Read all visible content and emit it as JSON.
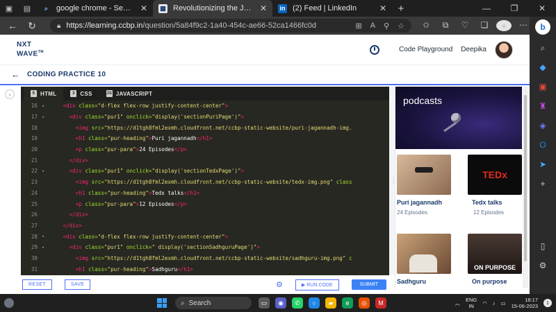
{
  "browser": {
    "tabs": [
      {
        "title": "google chrome - Search",
        "favicon": "search-icon",
        "active": false
      },
      {
        "title": "Revolutionizing the Job Market |",
        "favicon": "ccbp-icon",
        "active": true
      },
      {
        "title": "(2) Feed | LinkedIn",
        "favicon": "in",
        "active": false
      }
    ],
    "url_host": "https://learning.ccbp.in",
    "url_path": "/question/5a84f9c2-1a40-454c-ae66-52ca1466fc0d"
  },
  "header": {
    "logo_line1": "NXT",
    "logo_line2": "WAVE",
    "logo_tm": "TM",
    "code_playground": "Code Playground",
    "username": "Deepika"
  },
  "practice": {
    "title": "CODING PRACTICE 10"
  },
  "editor": {
    "tabs": [
      {
        "label": "HTML",
        "icon": "html-file-icon",
        "active": true
      },
      {
        "label": "CSS",
        "icon": "css-file-icon",
        "active": false
      },
      {
        "label": "JAVASCRIPT",
        "icon": "js-file-icon",
        "active": false
      }
    ],
    "lines": [
      {
        "n": "16",
        "fold": true,
        "indent": 4,
        "tag": "<div",
        "attrs": [
          [
            "class=",
            "\"d-flex flex-row justify-content-center\""
          ]
        ],
        "tail": ">"
      },
      {
        "n": "17",
        "fold": true,
        "indent": 6,
        "tag": "<div",
        "attrs": [
          [
            "class=",
            "\"pur1\""
          ],
          [
            " onclick=",
            "\"display('sectionPuriPage')\""
          ]
        ],
        "tail": ">"
      },
      {
        "n": "18",
        "fold": false,
        "indent": 8,
        "tag": "<img",
        "attrs": [
          [
            "src=",
            "\"https://d1tgh8fml2exmh.cloudfront.net/ccbp-static-website/puri-jagannadh-img."
          ]
        ],
        "tail": ""
      },
      {
        "n": "19",
        "fold": false,
        "indent": 8,
        "tag": "<h1",
        "attrs": [
          [
            "class=",
            "\"pur-heading\""
          ]
        ],
        "tail": ">Puri jagannadh</h1>"
      },
      {
        "n": "20",
        "fold": false,
        "indent": 8,
        "tag": "<p",
        "attrs": [
          [
            "class=",
            "\"pur-para\""
          ]
        ],
        "tail": ">24 Episodes</p>"
      },
      {
        "n": "21",
        "fold": false,
        "indent": 6,
        "tag": "</div>",
        "attrs": [],
        "tail": ""
      },
      {
        "n": "22",
        "fold": true,
        "indent": 6,
        "tag": "<div",
        "attrs": [
          [
            "class=",
            "\"pur1\""
          ],
          [
            " onclick=",
            "\"display('sectionTedxPage')\""
          ]
        ],
        "tail": ">"
      },
      {
        "n": "23",
        "fold": false,
        "indent": 8,
        "tag": "<img",
        "attrs": [
          [
            "src=",
            "\"https://d1tgh8fml2exmh.cloudfront.net/ccbp-static-website/tedx-img.png\""
          ],
          [
            " class",
            ""
          ]
        ],
        "tail": ""
      },
      {
        "n": "24",
        "fold": false,
        "indent": 8,
        "tag": "<h1",
        "attrs": [
          [
            "class=",
            "\"pur-heading\""
          ]
        ],
        "tail": ">Tedx talks</h1>"
      },
      {
        "n": "25",
        "fold": false,
        "indent": 8,
        "tag": "<p",
        "attrs": [
          [
            "class=",
            "\"pur-para\""
          ]
        ],
        "tail": ">12 Episodes</p>"
      },
      {
        "n": "26",
        "fold": false,
        "indent": 6,
        "tag": "</div>",
        "attrs": [],
        "tail": ""
      },
      {
        "n": "27",
        "fold": false,
        "indent": 4,
        "tag": "</div>",
        "attrs": [],
        "tail": ""
      },
      {
        "n": "28",
        "fold": true,
        "indent": 4,
        "tag": "<div",
        "attrs": [
          [
            "class=",
            "\"d-flex flex-row justify-content-center\""
          ]
        ],
        "tail": ">"
      },
      {
        "n": "29",
        "fold": true,
        "indent": 6,
        "tag": "<div",
        "attrs": [
          [
            "class=",
            "\"pur1\""
          ],
          [
            " onclick=",
            "\" display('sectionSadhguruPage')\""
          ]
        ],
        "tail": ">"
      },
      {
        "n": "30",
        "fold": false,
        "indent": 8,
        "tag": "<img",
        "attrs": [
          [
            "src=",
            "\"https://d1tgh8fml2exmh.cloudfront.net/ccbp-static-website/sadhguru-img.png\""
          ],
          [
            " c",
            ""
          ]
        ],
        "tail": ""
      },
      {
        "n": "31",
        "fold": false,
        "indent": 8,
        "tag": "<h1",
        "attrs": [
          [
            "class=",
            "\"pur-heading\""
          ]
        ],
        "tail": ">Sadhguru</h1>"
      }
    ],
    "buttons": {
      "reset": "RESET",
      "save": "SAVE",
      "run": "RUN CODE",
      "submit": "SUBMIT"
    }
  },
  "preview": {
    "banner_title": "podcasts",
    "cards": [
      {
        "name": "Puri jagannadh",
        "episodes": "24 Episodes"
      },
      {
        "name": "Tedx talks",
        "episodes": "12 Episodes",
        "thumb_text": "TEDx"
      },
      {
        "name": "Sadhguru",
        "episodes": ""
      },
      {
        "name": "On purpose",
        "episodes": "",
        "thumb_text": "ON PURPOSE"
      }
    ]
  },
  "taskbar": {
    "search_label": "Search",
    "lang_line1": "ENG",
    "lang_line2": "IN",
    "time": "18:17",
    "date": "15-06-2023",
    "notifications": "1"
  },
  "colors": {
    "accent": "#4c6ef5",
    "brand_navy": "#1b3a6b",
    "editor_bg": "#272822"
  }
}
